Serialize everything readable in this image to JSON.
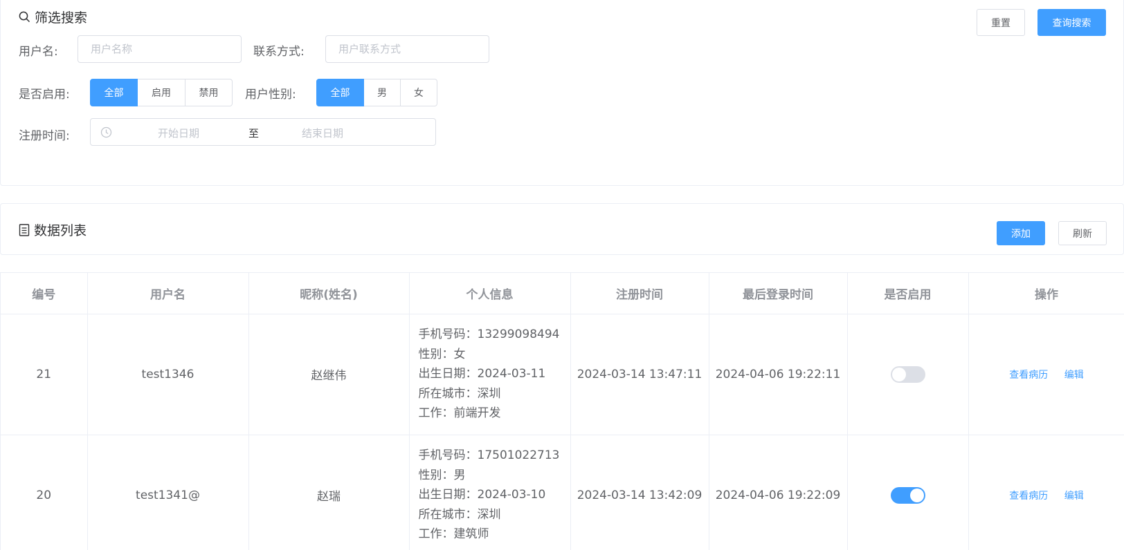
{
  "filter": {
    "title": "筛选搜索",
    "reset_label": "重置",
    "search_label": "查询搜索",
    "username_label": "用户名:",
    "username_placeholder": "用户名称",
    "contact_label": "联系方式:",
    "contact_placeholder": "用户联系方式",
    "enabled_label": "是否启用:",
    "enabled_options": [
      "全部",
      "启用",
      "禁用"
    ],
    "enabled_selected": "全部",
    "gender_label": "用户性别:",
    "gender_options": [
      "全部",
      "男",
      "女"
    ],
    "gender_selected": "全部",
    "regtime_label": "注册时间:",
    "start_placeholder": "开始日期",
    "range_separator": "至",
    "end_placeholder": "结束日期"
  },
  "list": {
    "title": "数据列表",
    "add_label": "添加",
    "refresh_label": "刷新"
  },
  "table": {
    "headers": [
      "编号",
      "用户名",
      "昵称(姓名)",
      "个人信息",
      "注册时间",
      "最后登录时间",
      "是否启用",
      "操作"
    ],
    "rows": [
      {
        "id": "21",
        "username": "test1346",
        "nickname": "赵继伟",
        "info": [
          "手机号码：13299098494",
          "性别：女",
          "出生日期：2024-03-11",
          "所在城市：深圳",
          "工作：前端开发"
        ],
        "register_time": "2024-03-14 13:47:11",
        "last_login": "2024-04-06 19:22:11",
        "enabled": false,
        "actions": [
          "查看病历",
          "编辑"
        ]
      },
      {
        "id": "20",
        "username": "test1341@",
        "nickname": "赵瑞",
        "info": [
          "手机号码：17501022713",
          "性别：男",
          "出生日期：2024-03-10",
          "所在城市：深圳",
          "工作：建筑师"
        ],
        "register_time": "2024-03-14 13:42:09",
        "last_login": "2024-04-06 19:22:09",
        "enabled": true,
        "actions": [
          "查看病历",
          "编辑"
        ]
      }
    ]
  },
  "colors": {
    "primary": "#409eff",
    "border": "#dcdfe6",
    "switch_off": "#dcdfe6"
  }
}
